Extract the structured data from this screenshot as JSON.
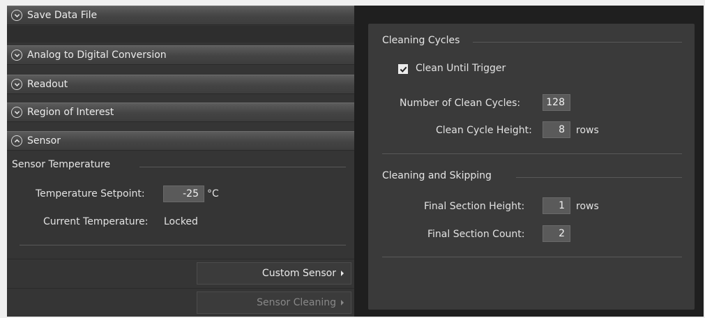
{
  "accordion": {
    "save_data_file": "Save Data File",
    "analog_to_digital": "Analog to Digital Conversion",
    "readout": "Readout",
    "region_of_interest": "Region of Interest",
    "sensor": "Sensor"
  },
  "sensor": {
    "group_title": "Sensor Temperature",
    "setpoint_label": "Temperature Setpoint:",
    "setpoint_value": "-25",
    "setpoint_unit": "°C",
    "current_label": "Current Temperature:",
    "current_value": "Locked",
    "custom_sensor_button": "Custom Sensor",
    "sensor_cleaning_button": "Sensor Cleaning"
  },
  "cleaning": {
    "cycles_title": "Cleaning Cycles",
    "clean_until_trigger_label": "Clean Until Trigger",
    "clean_until_trigger_checked": true,
    "num_cycles_label": "Number of Clean Cycles:",
    "num_cycles_value": "128",
    "cycle_height_label": "Clean Cycle Height:",
    "cycle_height_value": "8",
    "cycle_height_unit": "rows",
    "skipping_title": "Cleaning and Skipping",
    "final_height_label": "Final Section Height:",
    "final_height_value": "1",
    "final_height_unit": "rows",
    "final_count_label": "Final Section Count:",
    "final_count_value": "2"
  },
  "icons": {
    "expand": "chevron-down-icon",
    "collapse": "chevron-up-icon",
    "submenu": "triangle-right-icon",
    "check": "checkmark-icon"
  }
}
